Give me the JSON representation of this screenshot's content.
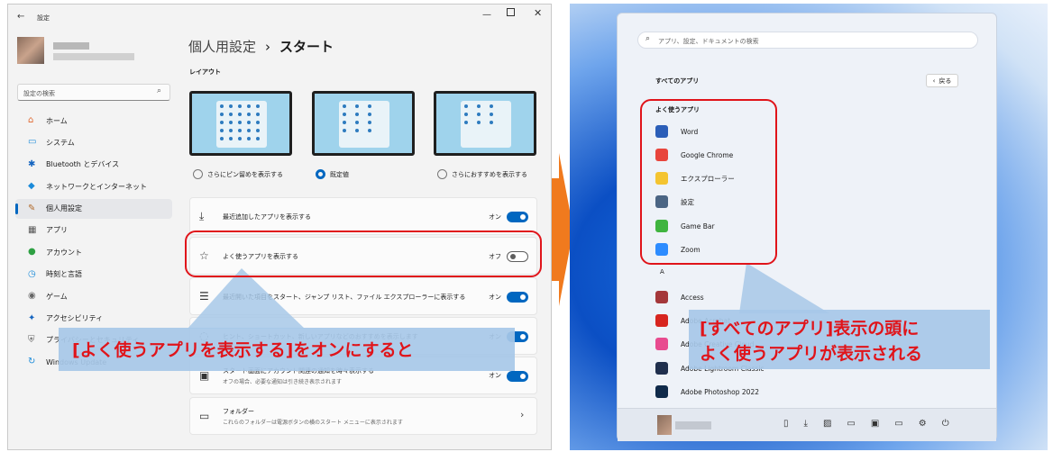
{
  "settings": {
    "window_title": "設定",
    "search_placeholder": "設定の検索",
    "breadcrumb_parent": "個人用設定",
    "breadcrumb_sep": "›",
    "breadcrumb_current": "スタート",
    "sidebar": [
      {
        "label": "ホーム",
        "icon": "home-icon"
      },
      {
        "label": "システム",
        "icon": "system-icon"
      },
      {
        "label": "Bluetooth とデバイス",
        "icon": "bluetooth-icon"
      },
      {
        "label": "ネットワークとインターネット",
        "icon": "network-icon"
      },
      {
        "label": "個人用設定",
        "icon": "pen-icon"
      },
      {
        "label": "アプリ",
        "icon": "apps-icon"
      },
      {
        "label": "アカウント",
        "icon": "account-icon"
      },
      {
        "label": "時刻と言語",
        "icon": "time-icon"
      },
      {
        "label": "ゲーム",
        "icon": "gamepad-icon"
      },
      {
        "label": "アクセシビリティ",
        "icon": "accessibility-icon"
      },
      {
        "label": "プライバシーとセキュリティ",
        "icon": "shield-icon"
      },
      {
        "label": "Windows Update",
        "icon": "update-icon"
      }
    ],
    "layout_heading": "レイアウト",
    "layout_options": [
      "さらにピン留めを表示する",
      "既定値",
      "さらにおすすめを表示する"
    ],
    "rows": [
      {
        "label": "最近追加したアプリを表示する",
        "state": "オン",
        "on": true,
        "icon": "download-icon"
      },
      {
        "label": "よく使うアプリを表示する",
        "state": "オフ",
        "on": false,
        "icon": "star-icon"
      },
      {
        "label": "最近開いた項目をスタート、ジャンプ リスト、ファイル エクスプローラーに表示する",
        "state": "オン",
        "on": true,
        "icon": "list-icon"
      },
      {
        "label": "ヒント、ショートカット、新しいアプリなどのおすすめを表示します",
        "state": "オン",
        "on": true,
        "icon": "bulb-icon"
      },
      {
        "label": "スタート画面にアカウント関連の通知を時々表示する",
        "sublabel": "オフの場合、必要な通知は引き続き表示されます",
        "state": "オン",
        "on": true,
        "icon": "account-notify-icon"
      },
      {
        "label": "フォルダー",
        "sublabel": "これらのフォルダーは電源ボタンの横のスタート メニューに表示されます",
        "icon": "folder-icon"
      }
    ]
  },
  "start_menu": {
    "search_placeholder": "アプリ、設定、ドキュメントの検索",
    "all_apps_title": "すべてのアプリ",
    "back_label": "戻る",
    "frequent_heading": "よく使うアプリ",
    "frequent_apps": [
      {
        "name": "Word",
        "color": "#2b5eb8"
      },
      {
        "name": "Google Chrome",
        "color": "#e8453c"
      },
      {
        "name": "エクスプローラー",
        "color": "#f4c430"
      },
      {
        "name": "設定",
        "color": "#4b6584"
      },
      {
        "name": "Game Bar",
        "color": "#3fb43f"
      },
      {
        "name": "Zoom",
        "color": "#2d8cff"
      }
    ],
    "letter_a": "A",
    "a_apps": [
      {
        "name": "Access",
        "color": "#a4373a"
      },
      {
        "name": "Adobe Acrobat",
        "color": "#d7251f"
      },
      {
        "name": "Adobe Creative Cloud",
        "color": "#e84b8f"
      },
      {
        "name": "Adobe Lightroom Classic",
        "color": "#1f2f4d"
      },
      {
        "name": "Adobe Photoshop 2022",
        "color": "#0f2a4a"
      }
    ]
  },
  "annotations": {
    "left_callout": "[よく使うアプリを表示する]をオンにすると",
    "right_callout_line1": "[すべてのアプリ]表示の頭に",
    "right_callout_line2": "よく使うアプリが表示される",
    "arrow_color": "#f07a1e",
    "highlight_color": "#e0141a"
  }
}
